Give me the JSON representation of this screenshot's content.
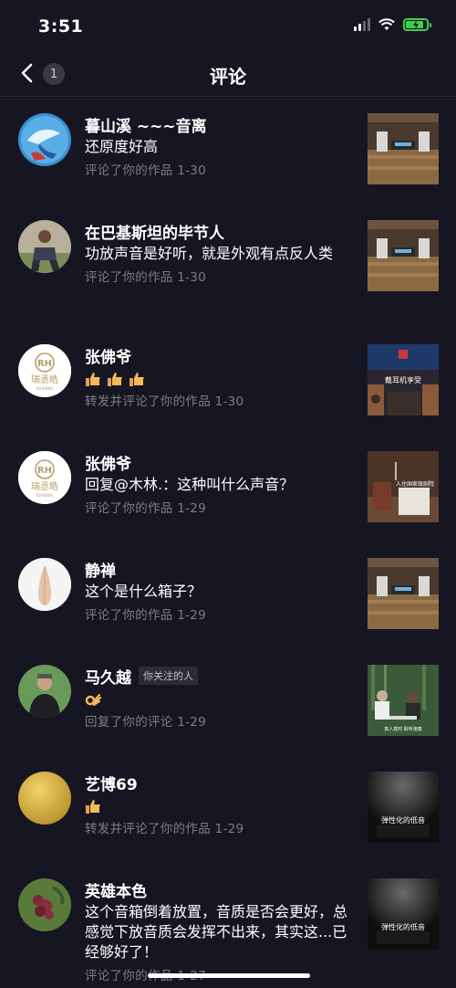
{
  "status_bar": {
    "time": "3:51"
  },
  "nav": {
    "back_count": "1",
    "title": "评论"
  },
  "comments": [
    {
      "name": "暮山溪 ~~~音离",
      "text": "还原度好高",
      "meta": "评论了你的作品  1-30"
    },
    {
      "name": "在巴基斯坦的毕节人",
      "text": "功放声音是好听，就是外观有点反人类",
      "meta": "评论了你的作品  1-30"
    },
    {
      "name": "张佛爷",
      "text": "",
      "meta": "转发并评论了你的作品  1-30",
      "emoji_count": 3
    },
    {
      "name": "张佛爷",
      "text": "回复@木林.：这种叫什么声音？",
      "meta": "评论了你的作品  1-29"
    },
    {
      "name": "静禅",
      "text": "这个是什么箱子？",
      "meta": "评论了你的作品  1-29"
    },
    {
      "name": "马久越",
      "tag": "你关注的人",
      "text": "",
      "meta": "回复了你的评论  1-29",
      "emoji": "ok-hand"
    },
    {
      "name": "艺博69",
      "text": "",
      "meta": "转发并评论了你的作品  1-29",
      "emoji": "thumbs-up"
    },
    {
      "name": "英雄本色",
      "text": "这个音箱倒着放置，音质是否会更好，总感觉下放音质会发挥不出来，其实这...已经够好了！",
      "meta": "评论了你的作品  1-27"
    }
  ],
  "thumbnails": [
    {
      "caption": ""
    },
    {
      "caption": ""
    },
    {
      "caption": "戴耳机享受"
    },
    {
      "caption": "入住国家级剧院"
    },
    {
      "caption": ""
    },
    {
      "caption": "真人真时 聆听演奏"
    },
    {
      "caption": "弹性化的低音"
    },
    {
      "caption": "弹性化的低音"
    }
  ],
  "avatar_logo": {
    "letters": "RH",
    "brand": "瑞丞皓",
    "sub": "RUIHENG"
  },
  "colors": {
    "background": "#161622",
    "meta": "#7d7d88",
    "battery": "#3ecf4c"
  }
}
